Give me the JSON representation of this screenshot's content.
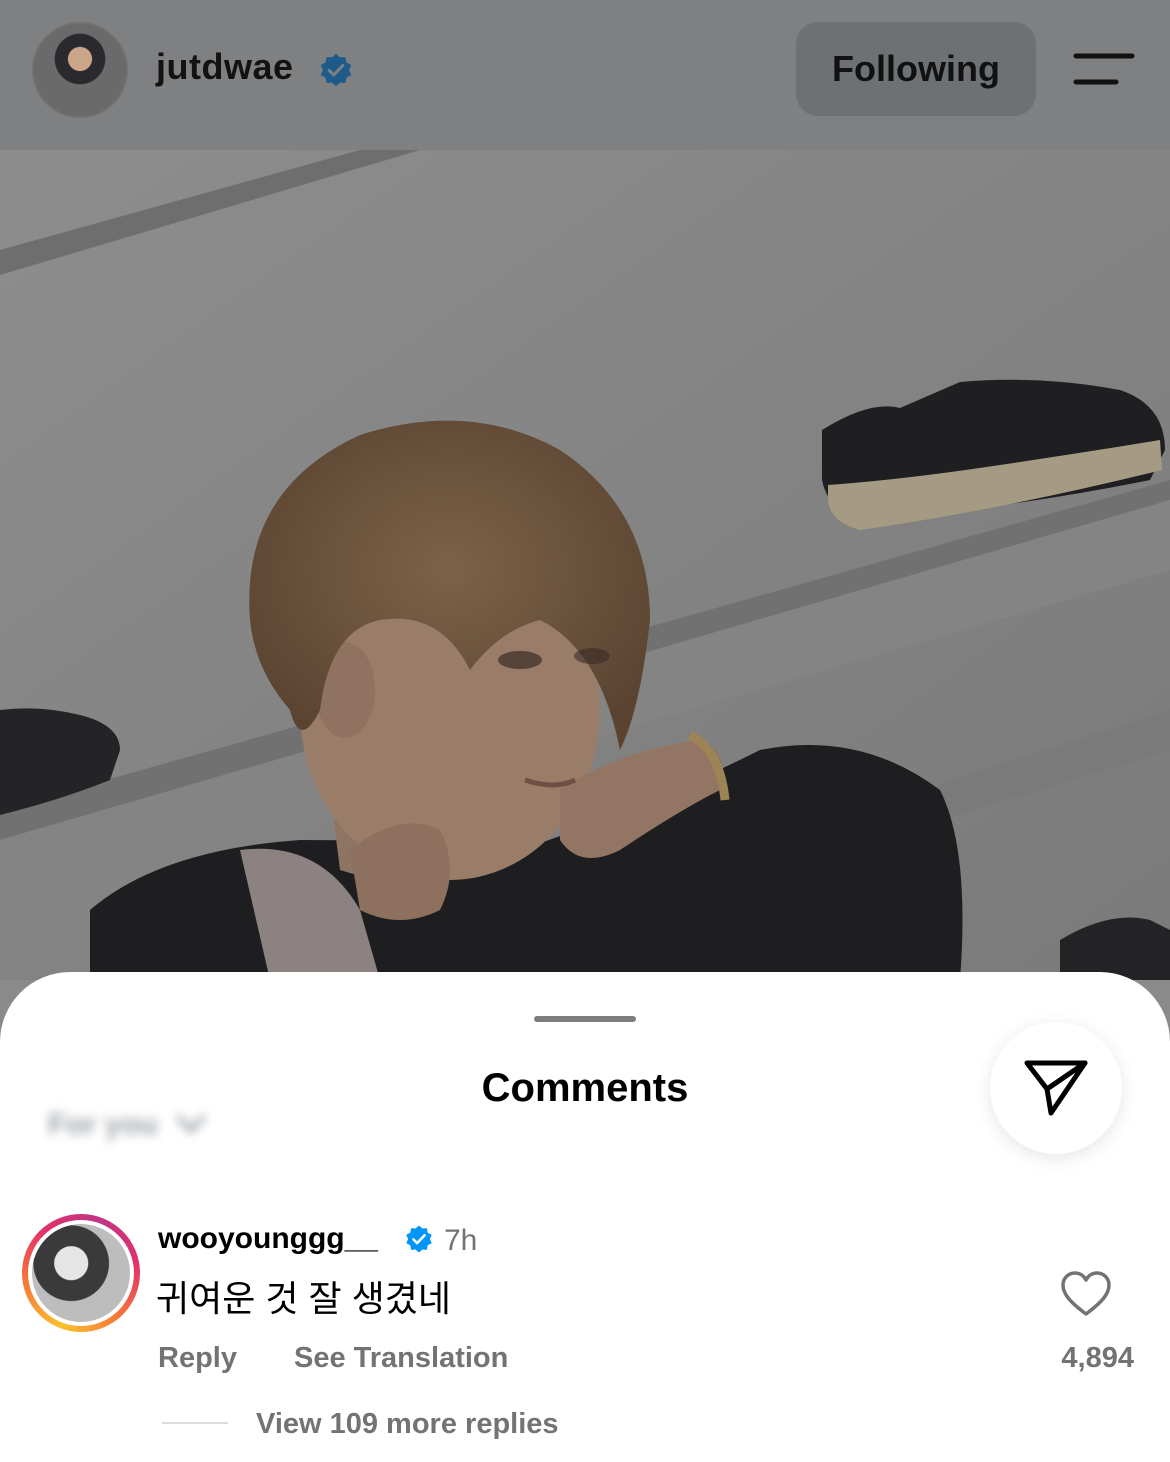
{
  "header": {
    "username": "jutdwae",
    "verified": true,
    "follow_button_label": "Following"
  },
  "post_image": {
    "subject": "photo"
  },
  "comments_sheet": {
    "title": "Comments",
    "sort_label": "For you"
  },
  "comment": {
    "username": "wooyounggg__",
    "verified": true,
    "time": "7h",
    "text": "귀여운 것 잘 생겼네",
    "reply_label": "Reply",
    "translate_label": "See Translation",
    "like_count": "4,894",
    "view_replies_label": "View 109 more replies"
  },
  "colors": {
    "verified_blue": "#0095f6",
    "secondary_text": "#737373",
    "overlay_dim": "#7f8081"
  }
}
